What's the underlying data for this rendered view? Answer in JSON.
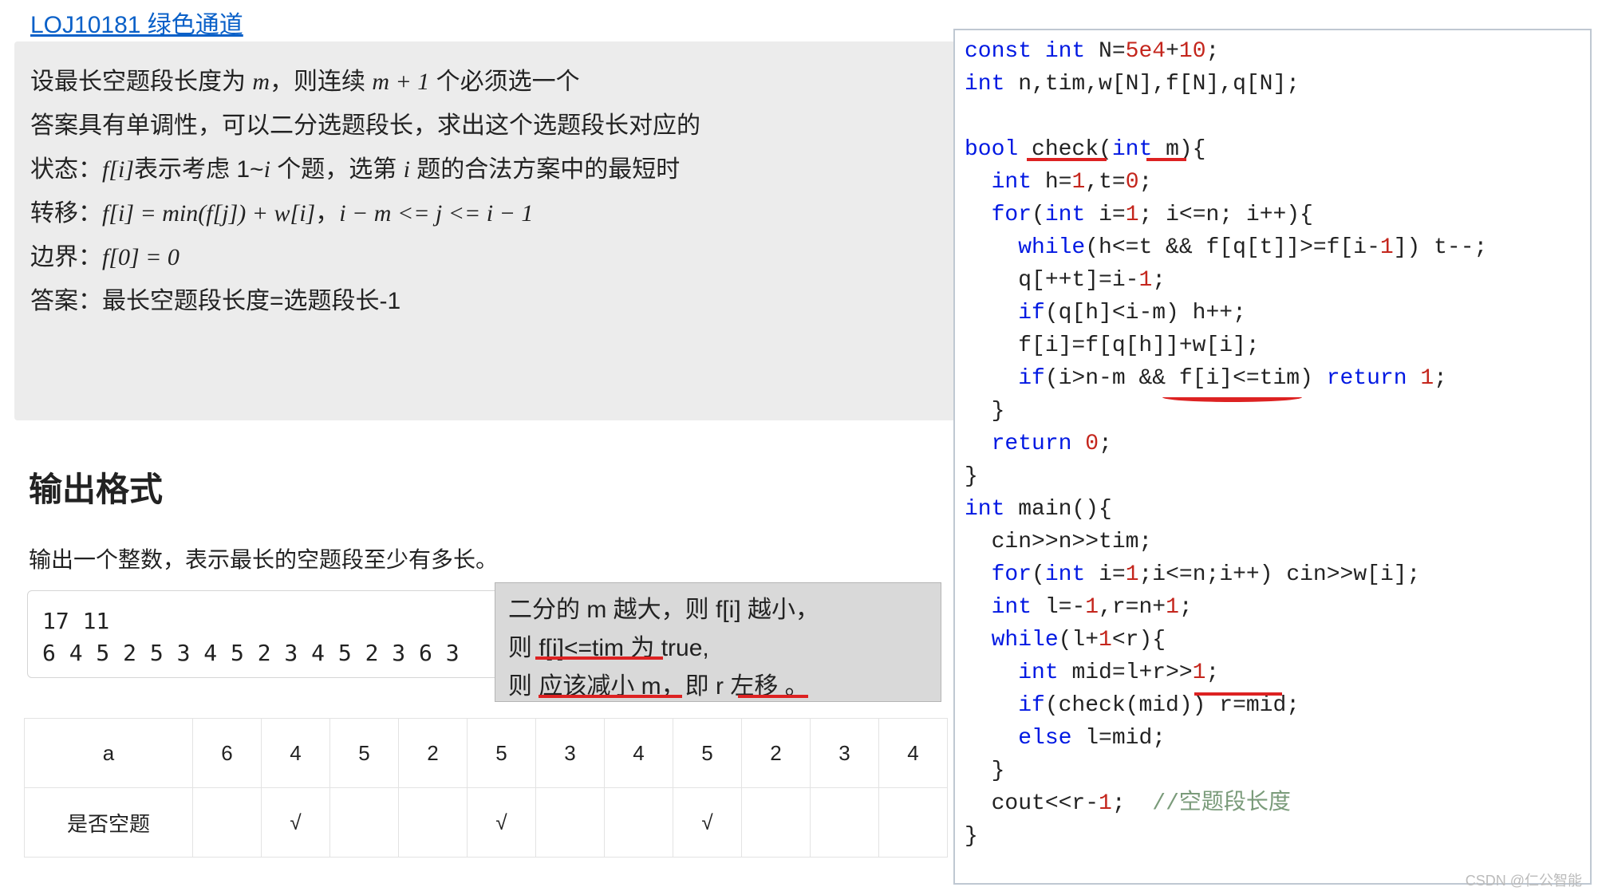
{
  "title_link": "LOJ10181 绿色通道",
  "explain": {
    "l1a": "设最长空题段长度为 ",
    "l1_m": "m",
    "l1b": "，则连续 ",
    "l1_m1": "m + 1",
    "l1c": " 个必须选一个",
    "l2": "答案具有单调性，可以二分选题段长，求出这个选题段长对应的",
    "l3a": "状态：",
    "l3_fi": "f[i]",
    "l3b": "表示考虑 1~",
    "l3_i": "i",
    "l3c": " 个题，选第 ",
    "l3_i2": "i",
    "l3d": " 题的合法方案中的最短时",
    "l4a": "转移：",
    "l4_eq": "f[i] = min(f[j]) + w[i]",
    "l4b": "，",
    "l4_rng": "i − m <= j <= i − 1",
    "l5a": "边界：",
    "l5_eq": "f[0] = 0",
    "l6": "答案：最长空题段长度=选题段长-1"
  },
  "section_title": "输出格式",
  "output_desc": "输出一个整数，表示最长的空题段至少有多长。",
  "sample": {
    "line1": "17 11",
    "line2": "6 4 5 2 5 3 4 5 2 3 4 5 2 3 6 3"
  },
  "tooltip": {
    "l1": "二分的 m 越大，则 f[i] 越小，",
    "l2": "则 f[i]<=tim 为 true,",
    "l3": "则 应该减小 m，即 r 左移 。"
  },
  "table": {
    "row1": [
      "a",
      "6",
      "4",
      "5",
      "2",
      "5",
      "3",
      "4",
      "5",
      "2",
      "3",
      "4"
    ],
    "row2": [
      "是否空题",
      "",
      "√",
      "",
      "",
      "√",
      "",
      "",
      "√",
      "",
      "",
      ""
    ]
  },
  "code": {
    "c01a": "const int",
    "c01b": " N=",
    "c01c": "5e4",
    "c01d": "+",
    "c01e": "10",
    "c01f": ";",
    "c02a": "int",
    "c02b": " n,tim,w[N],f[N],q[N];",
    "c03": "",
    "c04a": "bool",
    "c04b": " check(",
    "c04c": "int",
    "c04d": " m){",
    "c05a": "  ",
    "c05b": "int",
    "c05c": " h=",
    "c05d": "1",
    "c05e": ",t=",
    "c05f": "0",
    "c05g": ";",
    "c06a": "  ",
    "c06b": "for",
    "c06c": "(",
    "c06d": "int",
    "c06e": " i=",
    "c06f": "1",
    "c06g": "; i<=n; i++){",
    "c07a": "    ",
    "c07b": "while",
    "c07c": "(h<=t && f[q[t]]>=f[i-",
    "c07d": "1",
    "c07e": "]) t--;",
    "c08": "    q[++t]=i-",
    "c08b": "1",
    "c08c": ";",
    "c09": "    ",
    "c09b": "if",
    "c09c": "(q[h]<i-m) h++;",
    "c10": "    f[i]=f[q[h]]+w[i];",
    "c11a": "    ",
    "c11b": "if",
    "c11c": "(i>n-m && f[i]<=tim) ",
    "c11d": "return",
    "c11e": " ",
    "c11f": "1",
    "c11g": ";",
    "c12": "  }",
    "c13a": "  ",
    "c13b": "return",
    "c13c": " ",
    "c13d": "0",
    "c13e": ";",
    "c14": "}",
    "c15a": "int",
    "c15b": " main(){",
    "c16": "  cin>>n>>tim;",
    "c17a": "  ",
    "c17b": "for",
    "c17c": "(",
    "c17d": "int",
    "c17e": " i=",
    "c17f": "1",
    "c17g": ";i<=n;i++) cin>>w[i];",
    "c18a": "  ",
    "c18b": "int",
    "c18c": " l=-",
    "c18d": "1",
    "c18e": ",r=n+",
    "c18f": "1",
    "c18g": ";",
    "c19a": "  ",
    "c19b": "while",
    "c19c": "(l+",
    "c19d": "1",
    "c19e": "<r){",
    "c20a": "    ",
    "c20b": "int",
    "c20c": " mid=l+r>>",
    "c20d": "1",
    "c20e": ";",
    "c21a": "    ",
    "c21b": "if",
    "c21c": "(check(mid)) r=mid;",
    "c22a": "    ",
    "c22b": "else",
    "c22c": " l=mid;",
    "c23": "  }",
    "c24a": "  cout<<r-",
    "c24b": "1",
    "c24c": ";  ",
    "c24d": "//空题段长度",
    "c25": "}"
  },
  "watermark": "CSDN @仁公智能"
}
